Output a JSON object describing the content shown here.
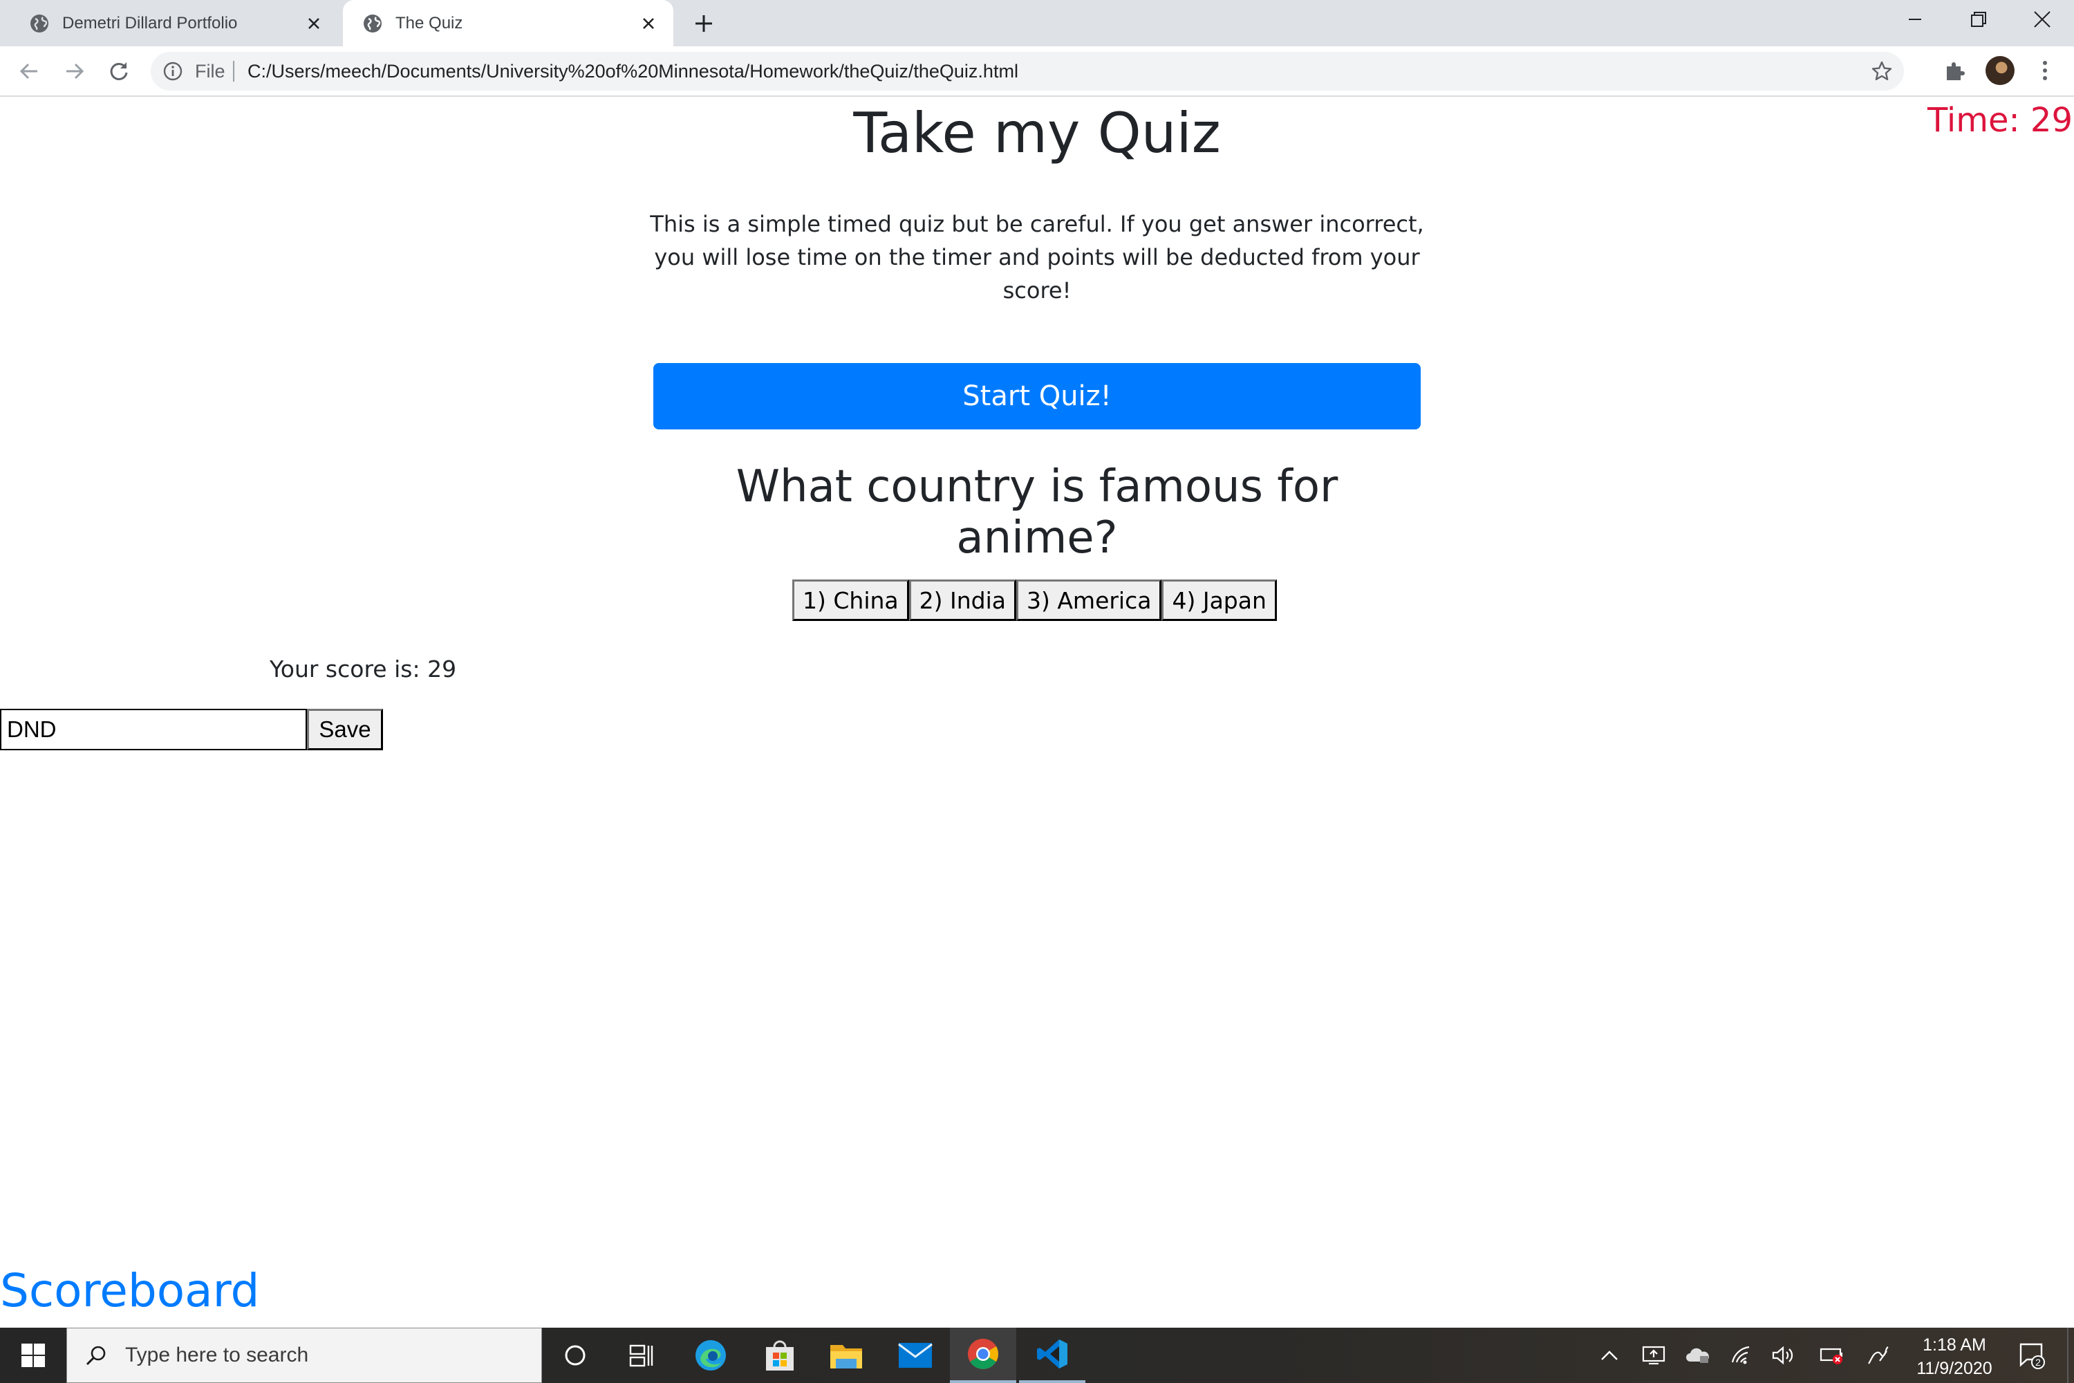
{
  "browser": {
    "tabs": [
      {
        "title": "Demetri Dillard Portfolio",
        "active": false
      },
      {
        "title": "The Quiz",
        "active": true
      }
    ],
    "address": {
      "scheme_label": "File",
      "url": "C:/Users/meech/Documents/University%20of%20Minnesota/Homework/theQuiz/theQuiz.html"
    }
  },
  "page": {
    "timer": "Time: 29",
    "title": "Take my Quiz",
    "intro": "This is a simple timed quiz but be careful. If you get answer incorrect, you will lose time on the timer and points will be deducted from your score!",
    "start_button": "Start Quiz!",
    "question": "What country is famous for anime?",
    "answers": [
      "1) China",
      "2) India",
      "3) America",
      "4) Japan"
    ],
    "score_text": "Your score is: 29",
    "initials_value": "DND",
    "save_button": "Save",
    "scoreboard_link": "Scoreboard"
  },
  "taskbar": {
    "search_placeholder": "Type here to search",
    "time": "1:18 AM",
    "date": "11/9/2020",
    "notification_count": "2",
    "pinned_apps": [
      "cortana",
      "task-view",
      "edge",
      "microsoft-store",
      "file-explorer",
      "mail",
      "chrome",
      "vscode"
    ]
  },
  "colors": {
    "primary": "#007bff",
    "timer": "#dc143c",
    "text": "#212529",
    "tabstrip": "#dee1e6"
  }
}
